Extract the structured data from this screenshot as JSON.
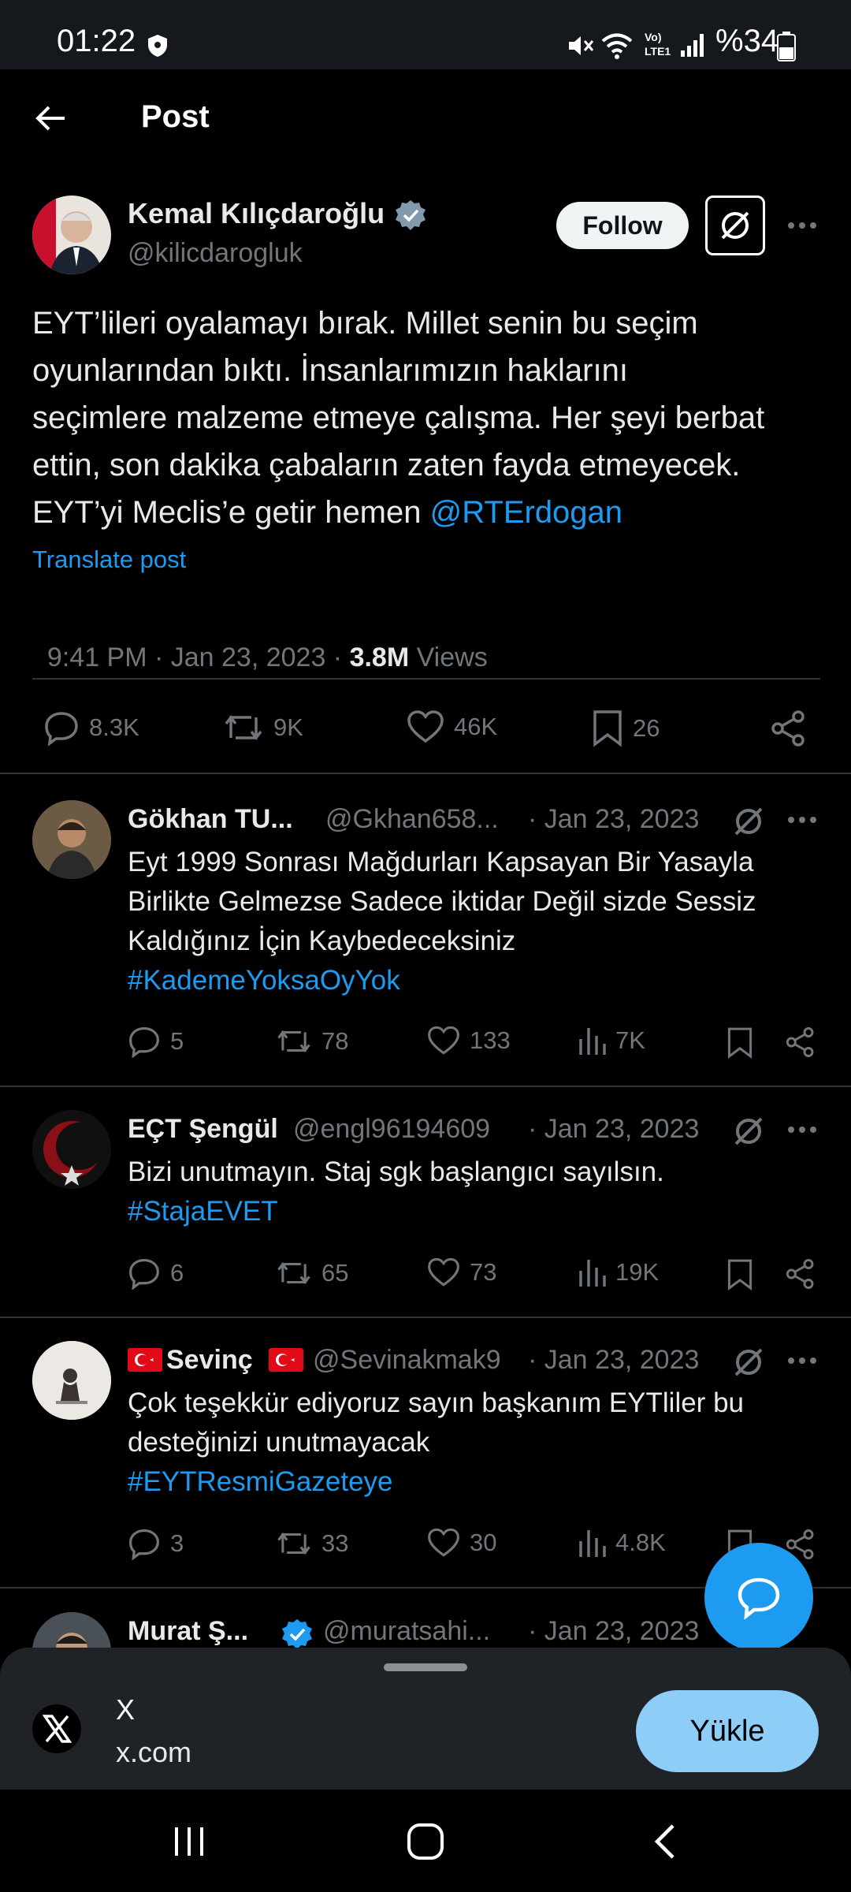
{
  "status_bar": {
    "time": "01:22",
    "battery": "%34"
  },
  "header": {
    "title": "Post"
  },
  "post": {
    "author_name": "Kemal Kılıçdaroğlu",
    "author_handle": "@kilicdarogluk",
    "follow_label": "Follow",
    "text_lines": [
      "EYT’lileri oyalamayı bırak. Millet senin bu seçim",
      "oyunlarından bıktı. İnsanlarımızın haklarını",
      "seçimlere malzeme etmeye çalışma. Her şeyi berbat",
      "ettin, son dakika çabaların zaten fayda etmeyecek."
    ],
    "last_line": "EYT’yi Meclis’e getir hemen ",
    "mention": "@RTErdogan",
    "translate": "Translate post",
    "timestamp": "9:41 PM · Jan 23, 2023 · ",
    "views_count": "3.8M",
    "views_label": " Views",
    "stats": {
      "replies": "8.3K",
      "reposts": "9K",
      "likes": "46K",
      "bookmarks": "26"
    }
  },
  "replies": [
    {
      "name": "Gökhan TU...",
      "handle": "@Gkhan658...",
      "date": "· Jan 23, 2023",
      "lines": [
        "Eyt 1999 Sonrası Mağdurları Kapsayan Bir Yasayla",
        "Birlikte Gelmezse Sadece iktidar Değil sizde Sessiz",
        "Kaldığınız İçin Kaybedeceksiniz"
      ],
      "hashtag": "#KademeYoksaOyYok",
      "replies": "5",
      "reposts": "78",
      "likes": "133",
      "views": "7K"
    },
    {
      "name": "EÇT Şengül",
      "handle": "@engl96194609",
      "date": "· Jan 23, 2023",
      "lines": [
        "Bizi unutmayın. Staj sgk başlangıcı sayılsın."
      ],
      "hashtag": "#StajaEVET",
      "replies": "6",
      "reposts": "65",
      "likes": "73",
      "views": "19K"
    },
    {
      "name": "Sevinç",
      "handle": "@Sevinakmak9",
      "date": "· Jan 23, 2023",
      "lines": [
        "Çok teşekkür ediyoruz sayın başkanım EYTliler bu",
        "desteğinizi unutmayacak"
      ],
      "hashtag": "#EYTResmiGazeteye",
      "replies": "3",
      "reposts": "33",
      "likes": "30",
      "views": "4.8K"
    },
    {
      "name": "Murat Ş...",
      "handle": "@muratsahi...",
      "date": "· Jan 23, 2023"
    }
  ],
  "install_banner": {
    "app_name": "X",
    "domain": "x.com",
    "install_label": "Yükle"
  },
  "colors": {
    "accent": "#1d9bf0",
    "background": "#000000",
    "secondary_text": "#71767b"
  }
}
